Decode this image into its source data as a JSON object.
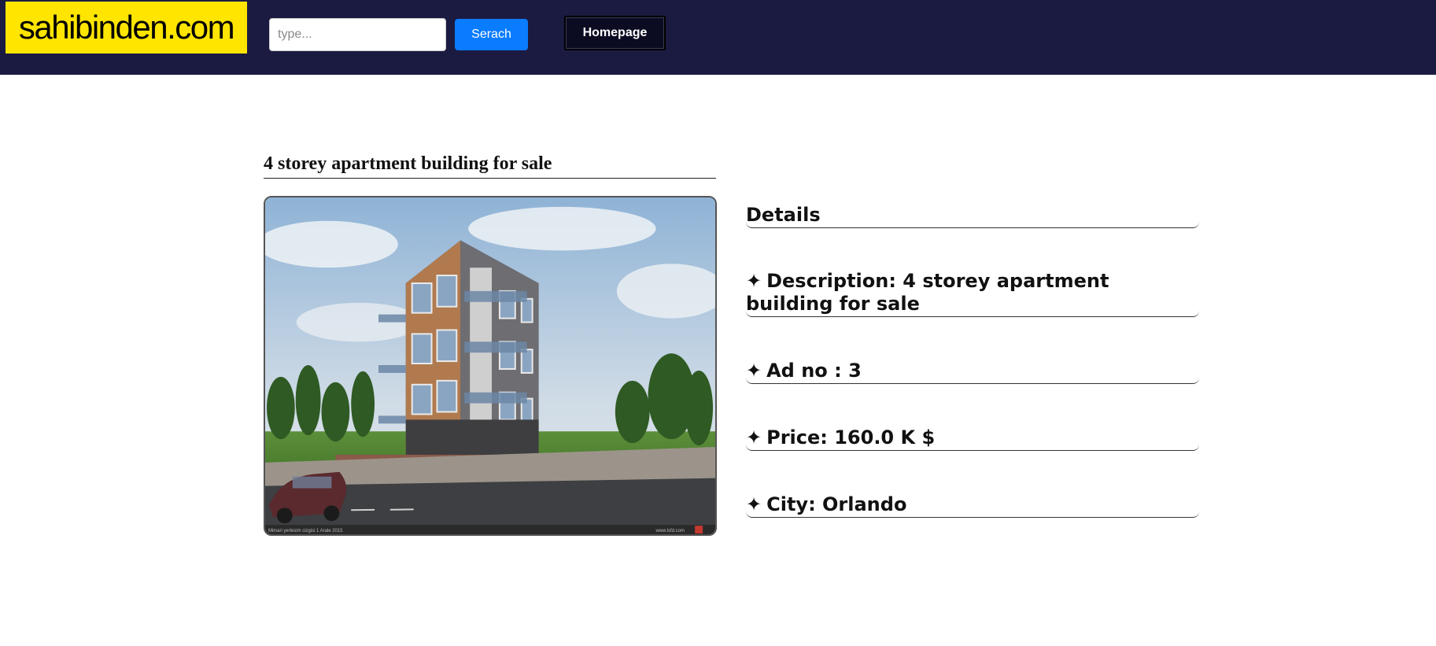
{
  "header": {
    "logo": "sahibinden.com",
    "search_placeholder": "type...",
    "search_button": "Serach",
    "home_button": "Homepage"
  },
  "listing": {
    "title": "4 storey apartment building for sale",
    "photo_caption_left": "Mimari yerlesim cizgisi 1 Arale 2015",
    "photo_caption_right": "www.lsfd.com",
    "details_heading": "Details",
    "star": "✦",
    "description": "Description: 4 storey apartment building for sale",
    "ad_no": "Ad no : 3",
    "price": "Price: 160.0 K $",
    "city": "City: Orlando"
  },
  "colors": {
    "header_bg": "#1b1b41",
    "logo_bg": "#ffe500",
    "search_button_bg": "#0a7cff",
    "home_button_bg": "#0b0b22"
  }
}
